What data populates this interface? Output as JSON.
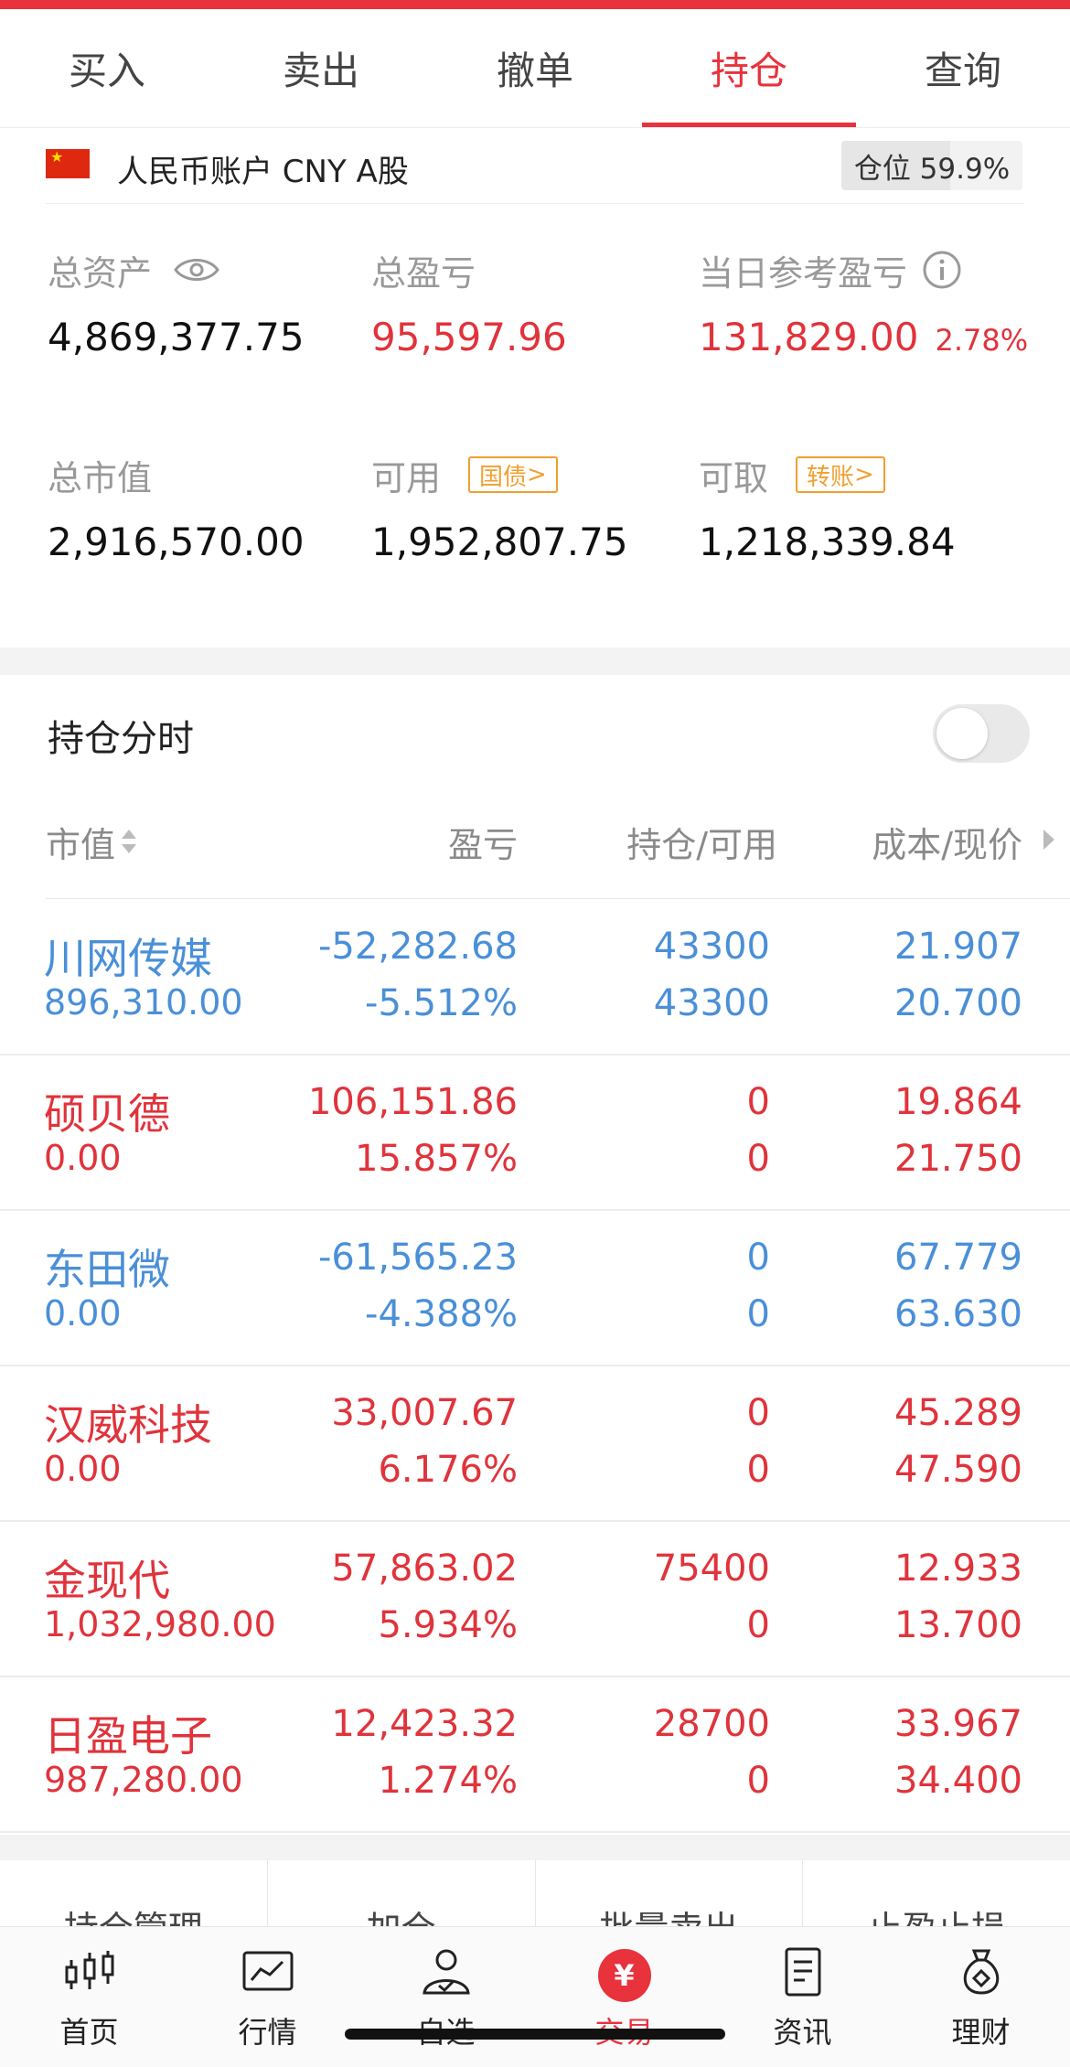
{
  "tabs": [
    {
      "label": "买入"
    },
    {
      "label": "卖出"
    },
    {
      "label": "撤单"
    },
    {
      "label": "持仓",
      "active": true
    },
    {
      "label": "查询"
    }
  ],
  "account": {
    "name": "人民币账户 CNY A股",
    "position_ratio_label": "仓位 59.9%",
    "position_ratio": 0.599
  },
  "summary": {
    "total_assets": {
      "label": "总资产",
      "value": "4,869,377.75"
    },
    "total_pl": {
      "label": "总盈亏",
      "value": "95,597.96"
    },
    "daily_pl": {
      "label": "当日参考盈亏",
      "value": "131,829.00",
      "pct": "2.78%"
    },
    "market_value": {
      "label": "总市值",
      "value": "2,916,570.00"
    },
    "available": {
      "label": "可用",
      "tag": "国债",
      "value": "1,952,807.75"
    },
    "withdrawable": {
      "label": "可取",
      "tag": "转账",
      "value": "1,218,339.84"
    }
  },
  "holdings": {
    "title": "持仓分时",
    "toggle_on": false,
    "columns": {
      "market_value": "市值",
      "pl": "盈亏",
      "position": "持仓/可用",
      "price": "成本/现价"
    },
    "rows": [
      {
        "name": "川网传媒",
        "market_value": "896,310.00",
        "pl": "-52,282.68",
        "pl_pct": "-5.512%",
        "position": "43300",
        "available": "43300",
        "cost": "21.907",
        "current": "20.700",
        "color": "blue"
      },
      {
        "name": "硕贝德",
        "market_value": "0.00",
        "pl": "106,151.86",
        "pl_pct": "15.857%",
        "position": "0",
        "available": "0",
        "cost": "19.864",
        "current": "21.750",
        "color": "red"
      },
      {
        "name": "东田微",
        "market_value": "0.00",
        "pl": "-61,565.23",
        "pl_pct": "-4.388%",
        "position": "0",
        "available": "0",
        "cost": "67.779",
        "current": "63.630",
        "color": "blue"
      },
      {
        "name": "汉威科技",
        "market_value": "0.00",
        "pl": "33,007.67",
        "pl_pct": "6.176%",
        "position": "0",
        "available": "0",
        "cost": "45.289",
        "current": "47.590",
        "color": "red"
      },
      {
        "name": "金现代",
        "market_value": "1,032,980.00",
        "pl": "57,863.02",
        "pl_pct": "5.934%",
        "position": "75400",
        "available": "0",
        "cost": "12.933",
        "current": "13.700",
        "color": "red"
      },
      {
        "name": "日盈电子",
        "market_value": "987,280.00",
        "pl": "12,423.32",
        "pl_pct": "1.274%",
        "position": "28700",
        "available": "0",
        "cost": "33.967",
        "current": "34.400",
        "color": "red"
      }
    ]
  },
  "actions": [
    {
      "label": "持仓管理"
    },
    {
      "label": "加仓"
    },
    {
      "label": "批量卖出"
    },
    {
      "label": "止盈止损"
    }
  ],
  "bottom_nav": [
    {
      "label": "首页",
      "icon": "candlestick-icon"
    },
    {
      "label": "行情",
      "icon": "chart-icon"
    },
    {
      "label": "自选",
      "icon": "user-check-icon"
    },
    {
      "label": "交易",
      "icon": "yuan-icon",
      "active": true
    },
    {
      "label": "资讯",
      "icon": "document-icon"
    },
    {
      "label": "理财",
      "icon": "money-bag-icon"
    }
  ],
  "colors": {
    "accent": "#e8323c",
    "up": "#e0333b",
    "down": "#4a8fd8",
    "tag": "#f0a030"
  }
}
